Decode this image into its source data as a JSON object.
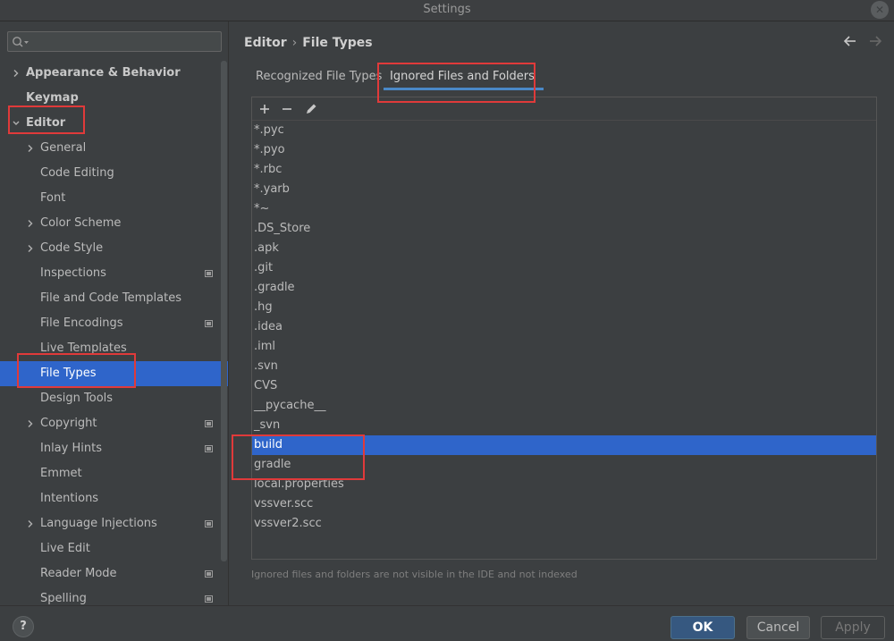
{
  "window": {
    "title": "Settings",
    "close_icon": "close-icon"
  },
  "search": {
    "placeholder": "",
    "value": ""
  },
  "tree": {
    "items": [
      {
        "label": "Appearance & Behavior",
        "expandable": true,
        "expanded": false,
        "bold": true,
        "level": 0
      },
      {
        "label": "Keymap",
        "expandable": false,
        "bold": true,
        "level": 0
      },
      {
        "label": "Editor",
        "expandable": true,
        "expanded": true,
        "bold": true,
        "level": 0
      },
      {
        "label": "General",
        "expandable": true,
        "expanded": false,
        "level": 1
      },
      {
        "label": "Code Editing",
        "level": 1
      },
      {
        "label": "Font",
        "level": 1
      },
      {
        "label": "Color Scheme",
        "expandable": true,
        "expanded": false,
        "level": 1
      },
      {
        "label": "Code Style",
        "expandable": true,
        "expanded": false,
        "level": 1
      },
      {
        "label": "Inspections",
        "level": 1,
        "project_icon": true
      },
      {
        "label": "File and Code Templates",
        "level": 1
      },
      {
        "label": "File Encodings",
        "level": 1,
        "project_icon": true
      },
      {
        "label": "Live Templates",
        "level": 1
      },
      {
        "label": "File Types",
        "level": 1,
        "selected": true
      },
      {
        "label": "Design Tools",
        "level": 1
      },
      {
        "label": "Copyright",
        "expandable": true,
        "expanded": false,
        "level": 1,
        "project_icon": true
      },
      {
        "label": "Inlay Hints",
        "level": 1,
        "project_icon": true
      },
      {
        "label": "Emmet",
        "level": 1
      },
      {
        "label": "Intentions",
        "level": 1
      },
      {
        "label": "Language Injections",
        "expandable": true,
        "expanded": false,
        "level": 1,
        "project_icon": true
      },
      {
        "label": "Live Edit",
        "level": 1
      },
      {
        "label": "Reader Mode",
        "level": 1,
        "project_icon": true
      },
      {
        "label": "Spelling",
        "level": 1,
        "project_icon": true
      }
    ]
  },
  "breadcrumb": {
    "parent": "Editor",
    "separator": "›",
    "current": "File Types"
  },
  "tabs": [
    {
      "label": "Recognized File Types",
      "active": false
    },
    {
      "label": "Ignored Files and Folders",
      "active": true
    }
  ],
  "toolbar": {
    "add_icon": "plus-icon",
    "remove_icon": "minus-icon",
    "edit_icon": "pencil-icon"
  },
  "ignored_list": [
    {
      "label": "*.pyc"
    },
    {
      "label": "*.pyo"
    },
    {
      "label": "*.rbc"
    },
    {
      "label": "*.yarb"
    },
    {
      "label": "*~"
    },
    {
      "label": ".DS_Store"
    },
    {
      "label": ".apk"
    },
    {
      "label": ".git"
    },
    {
      "label": ".gradle"
    },
    {
      "label": ".hg"
    },
    {
      "label": ".idea"
    },
    {
      "label": ".iml"
    },
    {
      "label": ".svn"
    },
    {
      "label": "CVS"
    },
    {
      "label": "__pycache__"
    },
    {
      "label": "_svn"
    },
    {
      "label": "build",
      "selected": true
    },
    {
      "label": "gradle"
    },
    {
      "label": "local.properties"
    },
    {
      "label": "vssver.scc"
    },
    {
      "label": "vssver2.scc"
    }
  ],
  "hint": "Ignored files and folders are not visible in the IDE and not indexed",
  "footer": {
    "help": "?",
    "ok": "OK",
    "cancel": "Cancel",
    "apply": "Apply"
  },
  "colors": {
    "accent": "#2f65ca",
    "highlight_box": "#e03a3a",
    "tab_underline": "#4a88c7"
  }
}
